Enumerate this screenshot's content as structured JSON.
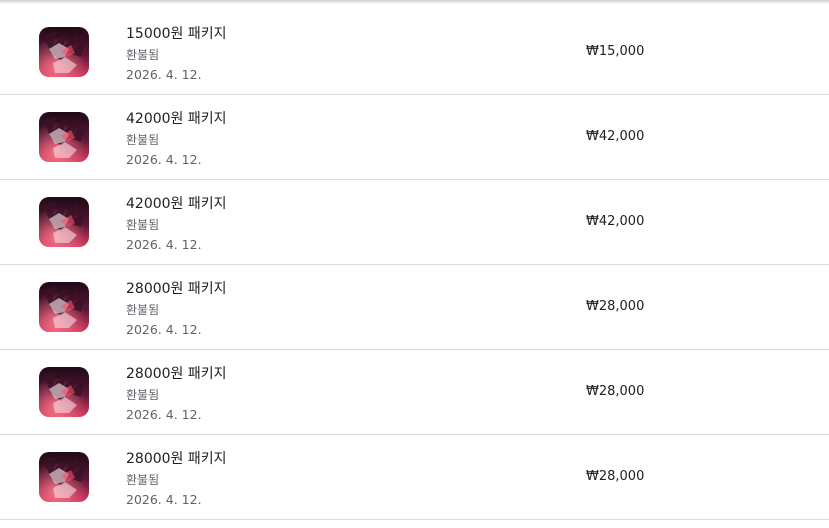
{
  "purchases": [
    {
      "title": "15000원 패키지",
      "status": "환불됨",
      "date": "2026. 4. 12.",
      "price": "₩15,000",
      "icon": "game-app-icon"
    },
    {
      "title": "42000원 패키지",
      "status": "환불됨",
      "date": "2026. 4. 12.",
      "price": "₩42,000",
      "icon": "game-app-icon"
    },
    {
      "title": "42000원 패키지",
      "status": "환불됨",
      "date": "2026. 4. 12.",
      "price": "₩42,000",
      "icon": "game-app-icon"
    },
    {
      "title": "28000원 패키지",
      "status": "환불됨",
      "date": "2026. 4. 12.",
      "price": "₩28,000",
      "icon": "game-app-icon"
    },
    {
      "title": "28000원 패키지",
      "status": "환불됨",
      "date": "2026. 4. 12.",
      "price": "₩28,000",
      "icon": "game-app-icon"
    },
    {
      "title": "28000원 패키지",
      "status": "환불됨",
      "date": "2026. 4. 12.",
      "price": "₩28,000",
      "icon": "game-app-icon"
    }
  ],
  "colors": {
    "icon_dark": "#2a0f1f",
    "icon_mid": "#8a1f4a",
    "icon_light": "#e04a6a",
    "divider": "#dadce0"
  }
}
